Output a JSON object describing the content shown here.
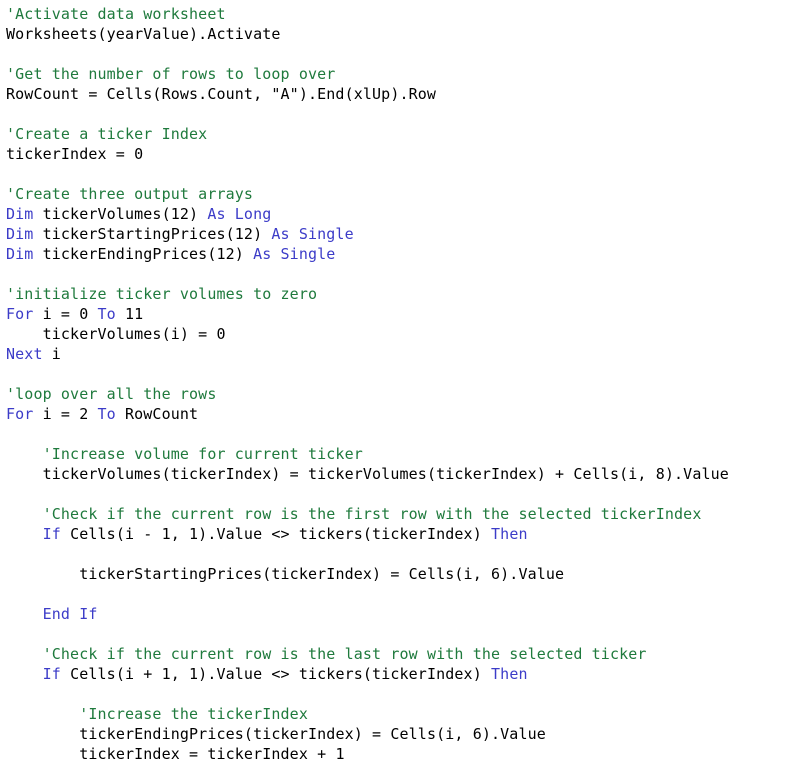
{
  "editor": {
    "language": "VBA",
    "background_color": "#ffffff",
    "comment_color": "#1f7a3d",
    "keyword_color": "#3c3cc8",
    "text_color": "#000000"
  },
  "code": {
    "lines": [
      {
        "id": 1,
        "indent": 0,
        "tokens": [
          {
            "type": "comment",
            "text": "'Activate data worksheet"
          }
        ]
      },
      {
        "id": 2,
        "indent": 0,
        "tokens": [
          {
            "type": "plain",
            "text": "Worksheets(yearValue).Activate"
          }
        ]
      },
      {
        "id": 3,
        "indent": 0,
        "tokens": []
      },
      {
        "id": 4,
        "indent": 0,
        "tokens": [
          {
            "type": "comment",
            "text": "'Get the number of rows to loop over"
          }
        ]
      },
      {
        "id": 5,
        "indent": 0,
        "tokens": [
          {
            "type": "plain",
            "text": "RowCount = Cells(Rows.Count, \"A\").End(xlUp).Row"
          }
        ]
      },
      {
        "id": 6,
        "indent": 0,
        "tokens": []
      },
      {
        "id": 7,
        "indent": 0,
        "tokens": [
          {
            "type": "comment",
            "text": "'Create a ticker Index"
          }
        ]
      },
      {
        "id": 8,
        "indent": 0,
        "tokens": [
          {
            "type": "plain",
            "text": "tickerIndex = 0"
          }
        ]
      },
      {
        "id": 9,
        "indent": 0,
        "tokens": []
      },
      {
        "id": 10,
        "indent": 0,
        "tokens": [
          {
            "type": "comment",
            "text": "'Create three output arrays"
          }
        ]
      },
      {
        "id": 11,
        "indent": 0,
        "tokens": [
          {
            "type": "keyword",
            "text": "Dim"
          },
          {
            "type": "plain",
            "text": " tickerVolumes(12) "
          },
          {
            "type": "keyword",
            "text": "As Long"
          }
        ]
      },
      {
        "id": 12,
        "indent": 0,
        "tokens": [
          {
            "type": "keyword",
            "text": "Dim"
          },
          {
            "type": "plain",
            "text": " tickerStartingPrices(12) "
          },
          {
            "type": "keyword",
            "text": "As Single"
          }
        ]
      },
      {
        "id": 13,
        "indent": 0,
        "tokens": [
          {
            "type": "keyword",
            "text": "Dim"
          },
          {
            "type": "plain",
            "text": " tickerEndingPrices(12) "
          },
          {
            "type": "keyword",
            "text": "As Single"
          }
        ]
      },
      {
        "id": 14,
        "indent": 0,
        "tokens": []
      },
      {
        "id": 15,
        "indent": 0,
        "tokens": [
          {
            "type": "comment",
            "text": "'initialize ticker volumes to zero"
          }
        ]
      },
      {
        "id": 16,
        "indent": 0,
        "tokens": [
          {
            "type": "keyword",
            "text": "For"
          },
          {
            "type": "plain",
            "text": " i = 0 "
          },
          {
            "type": "keyword",
            "text": "To"
          },
          {
            "type": "plain",
            "text": " 11"
          }
        ]
      },
      {
        "id": 17,
        "indent": 4,
        "tokens": [
          {
            "type": "plain",
            "text": "tickerVolumes(i) = 0"
          }
        ]
      },
      {
        "id": 18,
        "indent": 0,
        "tokens": [
          {
            "type": "keyword",
            "text": "Next"
          },
          {
            "type": "plain",
            "text": " i"
          }
        ]
      },
      {
        "id": 19,
        "indent": 0,
        "tokens": []
      },
      {
        "id": 20,
        "indent": 0,
        "tokens": [
          {
            "type": "comment",
            "text": "'loop over all the rows"
          }
        ]
      },
      {
        "id": 21,
        "indent": 0,
        "tokens": [
          {
            "type": "keyword",
            "text": "For"
          },
          {
            "type": "plain",
            "text": " i = 2 "
          },
          {
            "type": "keyword",
            "text": "To"
          },
          {
            "type": "plain",
            "text": " RowCount"
          }
        ]
      },
      {
        "id": 22,
        "indent": 0,
        "tokens": []
      },
      {
        "id": 23,
        "indent": 4,
        "tokens": [
          {
            "type": "comment",
            "text": "'Increase volume for current ticker"
          }
        ]
      },
      {
        "id": 24,
        "indent": 4,
        "tokens": [
          {
            "type": "plain",
            "text": "tickerVolumes(tickerIndex) = tickerVolumes(tickerIndex) + Cells(i, 8).Value"
          }
        ]
      },
      {
        "id": 25,
        "indent": 0,
        "tokens": []
      },
      {
        "id": 26,
        "indent": 4,
        "tokens": [
          {
            "type": "comment",
            "text": "'Check if the current row is the first row with the selected tickerIndex"
          }
        ]
      },
      {
        "id": 27,
        "indent": 4,
        "tokens": [
          {
            "type": "keyword",
            "text": "If"
          },
          {
            "type": "plain",
            "text": " Cells(i - 1, 1).Value <> tickers(tickerIndex) "
          },
          {
            "type": "keyword",
            "text": "Then"
          }
        ]
      },
      {
        "id": 28,
        "indent": 0,
        "tokens": []
      },
      {
        "id": 29,
        "indent": 8,
        "tokens": [
          {
            "type": "plain",
            "text": "tickerStartingPrices(tickerIndex) = Cells(i, 6).Value"
          }
        ]
      },
      {
        "id": 30,
        "indent": 0,
        "tokens": []
      },
      {
        "id": 31,
        "indent": 4,
        "tokens": [
          {
            "type": "keyword",
            "text": "End If"
          }
        ]
      },
      {
        "id": 32,
        "indent": 0,
        "tokens": []
      },
      {
        "id": 33,
        "indent": 4,
        "tokens": [
          {
            "type": "comment",
            "text": "'Check if the current row is the last row with the selected ticker"
          }
        ]
      },
      {
        "id": 34,
        "indent": 4,
        "tokens": [
          {
            "type": "keyword",
            "text": "If"
          },
          {
            "type": "plain",
            "text": " Cells(i + 1, 1).Value <> tickers(tickerIndex) "
          },
          {
            "type": "keyword",
            "text": "Then"
          }
        ]
      },
      {
        "id": 35,
        "indent": 0,
        "tokens": []
      },
      {
        "id": 36,
        "indent": 8,
        "tokens": [
          {
            "type": "comment",
            "text": "'Increase the tickerIndex"
          }
        ]
      },
      {
        "id": 37,
        "indent": 8,
        "tokens": [
          {
            "type": "plain",
            "text": "tickerEndingPrices(tickerIndex) = Cells(i, 6).Value"
          }
        ]
      },
      {
        "id": 38,
        "indent": 8,
        "tokens": [
          {
            "type": "plain",
            "text": "tickerIndex = tickerIndex + 1"
          }
        ]
      }
    ]
  }
}
